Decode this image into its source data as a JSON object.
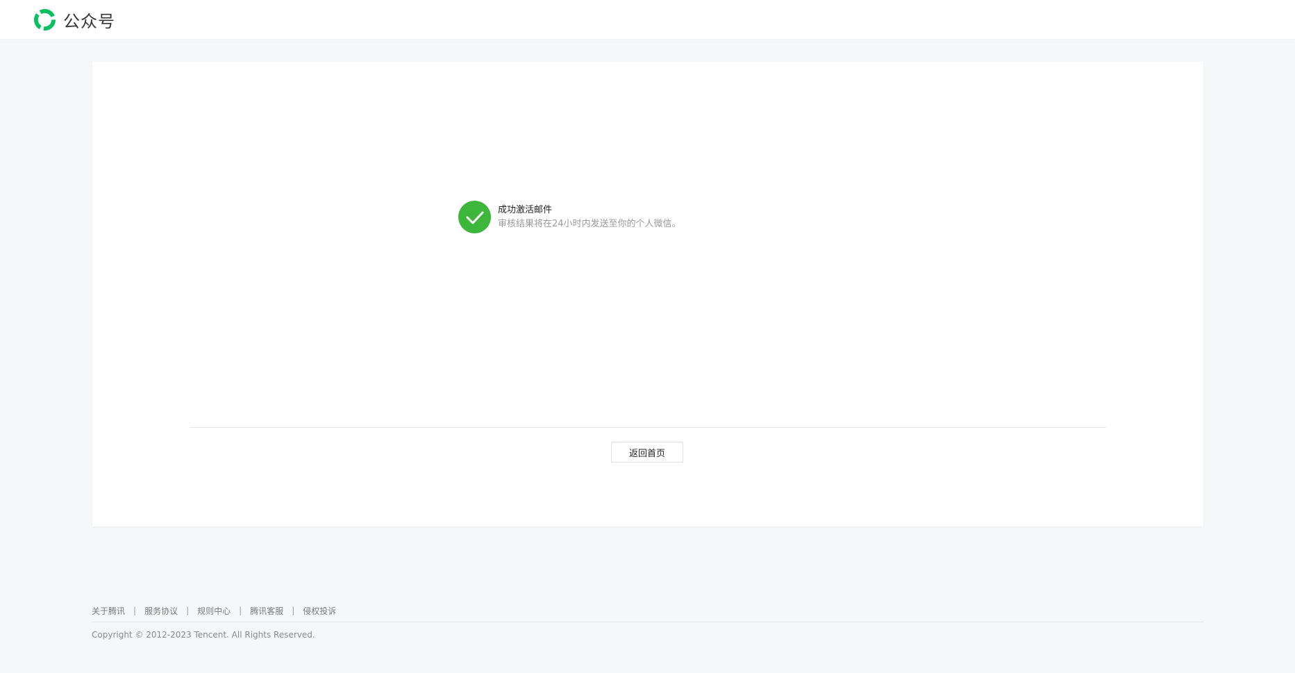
{
  "header": {
    "brand_name": "公众号",
    "logo_icon": "wechat-official-account-logo",
    "brand_color": "#07c160"
  },
  "result": {
    "icon": "check-circle-icon",
    "icon_color": "#3cb73c",
    "title": "成功激活邮件",
    "description": "审核结果将在24小时内发送至你的个人微信。"
  },
  "actions": {
    "home_label": "返回首页"
  },
  "footer": {
    "links": [
      "关于腾讯",
      "服务协议",
      "规则中心",
      "腾讯客服",
      "侵权投诉"
    ],
    "separator": "|",
    "copyright": "Copyright © 2012-2023 Tencent. All Rights Reserved."
  }
}
